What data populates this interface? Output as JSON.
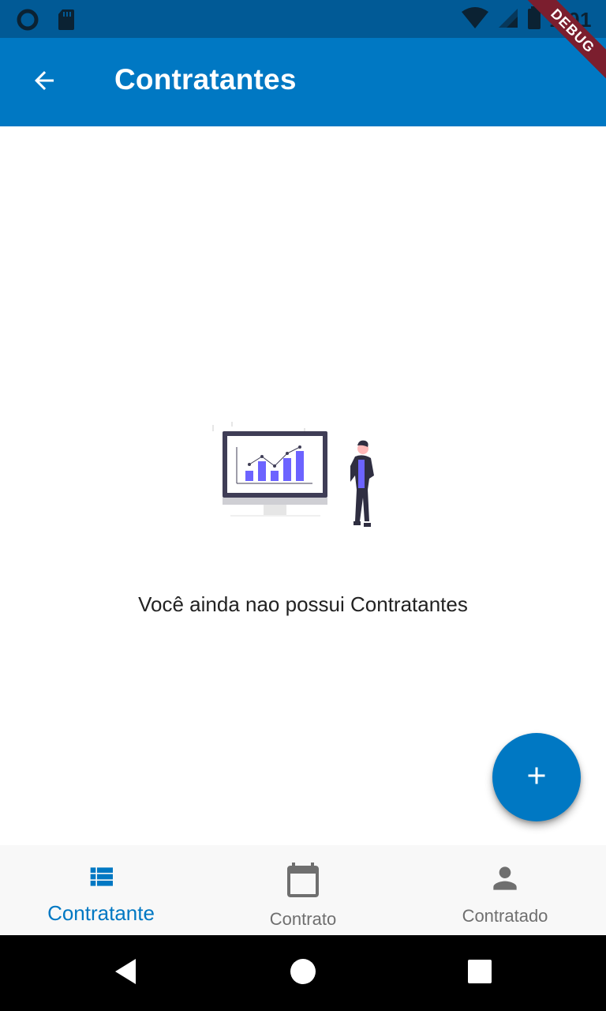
{
  "status_bar": {
    "time": "1:01"
  },
  "app_bar": {
    "title": "Contratantes"
  },
  "debug_banner": "DEBUG",
  "empty_state": {
    "message": "Você ainda nao possui Contratantes"
  },
  "bottom_nav": {
    "items": [
      {
        "label": "Contratante",
        "icon": "list-icon",
        "active": true
      },
      {
        "label": "Contrato",
        "icon": "calendar-icon",
        "active": false
      },
      {
        "label": "Contratado",
        "icon": "person-icon",
        "active": false
      }
    ]
  },
  "colors": {
    "primary": "#0078c3",
    "status_bar": "#015a96",
    "illustration_accent": "#6c63ff",
    "inactive_nav": "#6f6f6f"
  }
}
